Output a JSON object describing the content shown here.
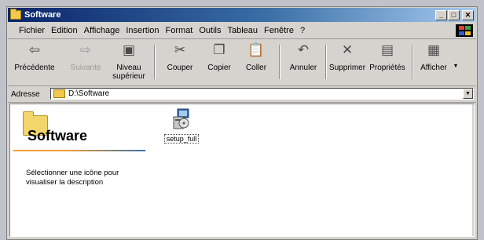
{
  "window": {
    "title": "Software"
  },
  "menu": [
    "Fichier",
    "Edition",
    "Affichage",
    "Insertion",
    "Format",
    "Outils",
    "Tableau",
    "Fenêtre",
    "?"
  ],
  "toolbar": {
    "back": "Précédente",
    "forward": "Suivante",
    "up_line1": "Niveau",
    "up_line2": "supérieur",
    "cut": "Couper",
    "copy": "Copier",
    "paste": "Coller",
    "undo": "Annuler",
    "delete": "Supprimer",
    "properties": "Propriétés",
    "view": "Afficher"
  },
  "address": {
    "label": "Adresse",
    "value": "D:\\Software"
  },
  "content": {
    "folder_title": "Software",
    "description": "Sélectionner une icône pour visualiser la description",
    "file_name": "setup_full"
  },
  "colors": {
    "titlebar_start": "#0a246a",
    "titlebar_end": "#a6caf0",
    "accent_orange": "#f0a030"
  }
}
